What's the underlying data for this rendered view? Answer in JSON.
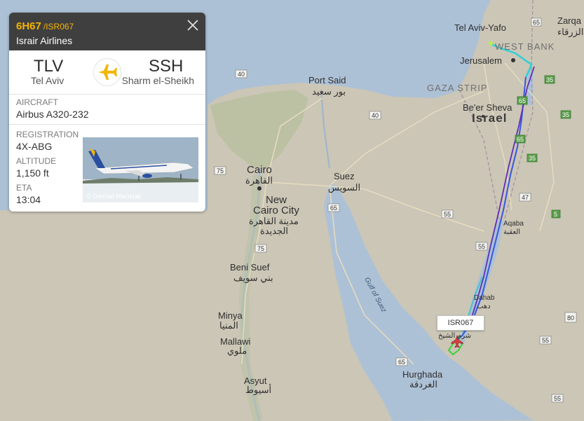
{
  "flight_panel": {
    "flight_number": "6H67",
    "callsign": "/ISR067",
    "airline": "Israir Airlines",
    "origin": {
      "code": "TLV",
      "city": "Tel Aviv"
    },
    "destination": {
      "code": "SSH",
      "city": "Sharm el-Sheikh"
    },
    "aircraft": {
      "label": "AIRCRAFT",
      "value": "Airbus A320-232"
    },
    "registration": {
      "label": "REGISTRATION",
      "value": "4X-ABG"
    },
    "altitude": {
      "label": "ALTITUDE",
      "value": "1,150 ft"
    },
    "eta": {
      "label": "ETA",
      "value": "13:04"
    },
    "photo_credit": "© Damian Maciejak",
    "accent_color": "#f5b400",
    "header_color": "#3f3f3f"
  },
  "map_label": {
    "callsign_tag": "ISR067"
  },
  "map": {
    "places": {
      "tel_aviv": "Tel Aviv-Yafo",
      "jerusalem": "Jerusalem",
      "zarqa_en": "Zarqa",
      "zarqa_ar": "الزرقاء",
      "west_bank": "WEST BANK",
      "gaza_strip": "GAZA STRIP",
      "port_said_en": "Port Said",
      "port_said_ar": "بور سعيد",
      "beer_sheva": "Be'er Sheva",
      "israel": "Israel",
      "cairo_en": "Cairo",
      "cairo_ar": "القاهرة",
      "suez_en": "Suez",
      "suez_ar": "السويس",
      "new_cairo_1": "New",
      "new_cairo_2": "Cairo City",
      "new_cairo_ar1": "مدينة القاهرة",
      "new_cairo_ar2": "الجديدة",
      "beni_suef_en": "Beni Suef",
      "beni_suef_ar": "بني سويف",
      "minya_en": "Minya",
      "minya_ar": "المنيا",
      "mallawi_en": "Mallawi",
      "mallawi_ar": "ملوي",
      "asyut_en": "Asyut",
      "asyut_ar": "أسيوط",
      "hurghada_en": "Hurghada",
      "hurghada_ar": "الغردقة",
      "aqaba_en": "Aqaba",
      "aqaba_ar": "العقبة",
      "dahab_en": "Dahab",
      "dahab_ar": "دهب",
      "sharm_ar": "شرم الشيخ",
      "gulf_of_suez": "Gulf of Suez"
    },
    "road_shields": [
      "65",
      "40",
      "40",
      "75",
      "65",
      "75",
      "55",
      "55",
      "65",
      "35",
      "35",
      "65",
      "35",
      "47",
      "5",
      "80",
      "55",
      "55",
      "65"
    ]
  }
}
